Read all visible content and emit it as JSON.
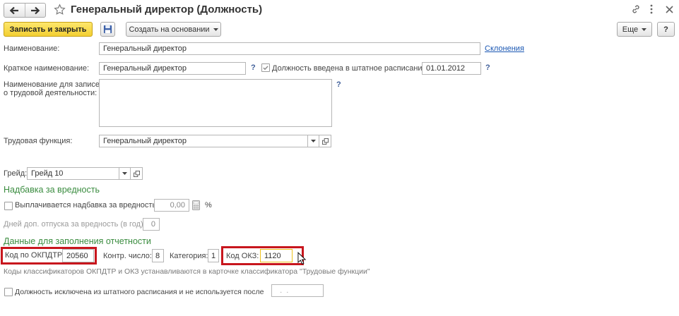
{
  "window": {
    "title": "Генеральный директор (Должность)"
  },
  "toolbar": {
    "save_close": "Записать и закрыть",
    "create_based": "Создать на основании",
    "more": "Еще",
    "help": "?"
  },
  "fields": {
    "name": {
      "label": "Наименование:",
      "value": "Генеральный директор",
      "link": "Склонения"
    },
    "short_name": {
      "label": "Краткое наименование:",
      "value": "Генеральный директор",
      "help": "?"
    },
    "in_schedule": {
      "label": "Должность введена в штатное расписание",
      "checked": true,
      "date": "01.01.2012",
      "help": "?"
    },
    "work_record_name": {
      "label": "Наименование для записей\nо трудовой деятельности:",
      "value": "",
      "help": "?"
    },
    "labor_function": {
      "label": "Трудовая функция:",
      "value": "Генеральный директор"
    },
    "grade": {
      "label": "Грейд:",
      "value": "Грейд 10"
    }
  },
  "hazard": {
    "heading": "Надбавка за вредность",
    "allowance_label": "Выплачивается надбавка за вредность",
    "allowance_checked": false,
    "allowance_value": "0,00",
    "percent": "%",
    "days_label": "Дней доп. отпуска за вредность (в год):",
    "days_value": "0"
  },
  "reporting": {
    "heading": "Данные для заполнения отчетности",
    "okpdtr_label": "Код по ОКПДТР:",
    "okpdtr_value": "20560",
    "control_label": "Контр. число:",
    "control_value": "8",
    "category_label": "Категория:",
    "category_value": "1",
    "okz_label": "Код ОКЗ:",
    "okz_value": "1120",
    "note": "Коды классификаторов ОКПДТР и ОКЗ устанавливаются в карточке классификатора \"Трудовые функции\""
  },
  "excluded": {
    "label": "Должность исключена из штатного расписания и не используется после",
    "checked": false,
    "date": "  .  .    "
  },
  "icons": {
    "back": "arrow-left-icon",
    "forward": "arrow-right-icon",
    "favorite": "star-icon",
    "link": "link-icon",
    "more": "more-vertical-icon",
    "close": "close-icon",
    "save": "floppy-disk-icon",
    "dropdown": "chevron-down-icon",
    "open": "open-form-icon",
    "calculator": "calculator-icon",
    "cursor": "mouse-cursor-icon"
  },
  "colors": {
    "accent_yellow": "#f3cf32",
    "heading_green": "#3a8c3f",
    "link_blue": "#1a57b3",
    "highlight_red": "#c8161d",
    "focus_yellow": "#eec21c",
    "help_blue": "#3e5e99"
  }
}
